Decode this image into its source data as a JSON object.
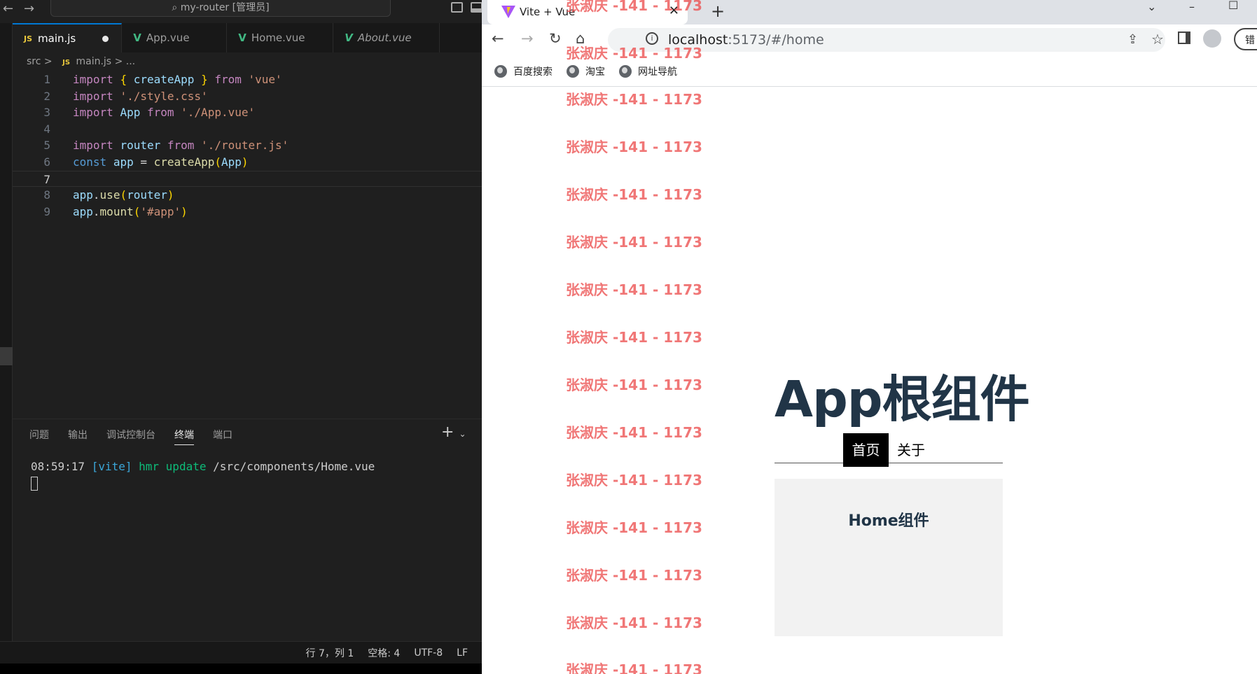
{
  "vscode": {
    "search_title": "my-router [管理员]",
    "tabs": [
      {
        "label": "main.js",
        "icon": "JS",
        "active": true
      },
      {
        "label": "App.vue",
        "icon": "V"
      },
      {
        "label": "Home.vue",
        "icon": "V"
      },
      {
        "label": "About.vue",
        "icon": "V"
      }
    ],
    "breadcrumb": {
      "folder": "src",
      "sep": ">",
      "file": "main.js",
      "tail": "> ..."
    },
    "line_numbers": [
      "1",
      "2",
      "3",
      "4",
      "5",
      "6",
      "7",
      "8",
      "9"
    ],
    "code": {
      "l1": {
        "a": "import",
        "b": "{",
        "c": "createApp",
        "d": "}",
        "e": "from",
        "f": "'vue'"
      },
      "l2": {
        "a": "import",
        "b": "'./style.css'"
      },
      "l3": {
        "a": "import",
        "b": "App",
        "c": "from",
        "d": "'./App.vue'"
      },
      "l5": {
        "a": "import",
        "b": "router",
        "c": "from",
        "d": "'./router.js'"
      },
      "l6": {
        "a": "const",
        "b": "app",
        "c": "=",
        "d": "createApp",
        "e": "(",
        "f": "App",
        "g": ")"
      },
      "l8": {
        "a": "app",
        "b": ".",
        "c": "use",
        "d": "(",
        "e": "router",
        "f": ")"
      },
      "l9": {
        "a": "app",
        "b": ".",
        "c": "mount",
        "d": "(",
        "e": "'#app'",
        "f": ")"
      }
    },
    "panel_tabs": [
      "问题",
      "输出",
      "调试控制台",
      "终端",
      "端口"
    ],
    "terminal": {
      "time": "08:59:17",
      "tag": "[vite]",
      "msg": "hmr update",
      "path": "/src/components/Home.vue"
    },
    "status": [
      "行 7，列 1",
      "空格: 4",
      "UTF-8",
      "LF"
    ]
  },
  "chrome": {
    "tab_title": "Vite + Vue",
    "url_host": "localhost",
    "url_rest": ":5173/#/home",
    "bookmarks": [
      "百度搜索",
      "淘宝",
      "网址导航"
    ],
    "profile_label": "错"
  },
  "page": {
    "title": "App根组件",
    "nav": {
      "home": "首页",
      "about": "关于"
    },
    "home_component": "Home组件"
  },
  "watermark": "张淑庆 -141 - 1173",
  "colors": {
    "vscode_bg": "#1f1f1f",
    "accent": "#0078d4",
    "vue_green": "#41b883",
    "title_text": "#213547",
    "watermark": "#ec5050"
  }
}
